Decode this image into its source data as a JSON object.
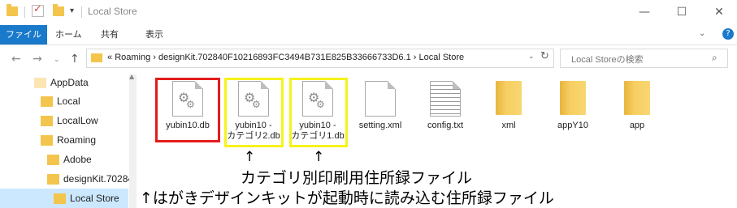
{
  "window": {
    "title": "Local Store",
    "minimize": "—",
    "maximize": "☐",
    "close": "✕"
  },
  "ribbon": {
    "tabs": [
      "ファイル",
      "ホーム",
      "共有",
      "表示"
    ]
  },
  "address": {
    "prefix": "«",
    "path": "Roaming  ›  designKit.702840F10216893FC3494B731E825B33666733D6.1  ›  Local Store"
  },
  "search": {
    "placeholder": "Local Storeの検索"
  },
  "nav_pane": {
    "items": [
      "AppData",
      "Local",
      "LocalLow",
      "Roaming",
      "Adobe",
      "designKit.70284",
      "Local Store"
    ]
  },
  "files": [
    {
      "name": "yubin10.db",
      "icon": "gear-doc"
    },
    {
      "name": "yubin10 -\nカテゴリ2.db",
      "icon": "gear-doc"
    },
    {
      "name": "yubin10 -\nカテゴリ1.db",
      "icon": "gear-doc"
    },
    {
      "name": "setting.xml",
      "icon": "doc"
    },
    {
      "name": "config.txt",
      "icon": "text-doc"
    },
    {
      "name": "xml",
      "icon": "folder"
    },
    {
      "name": "appY10",
      "icon": "folder"
    },
    {
      "name": "app",
      "icon": "folder"
    }
  ],
  "annotations": {
    "arrow": "↑",
    "line1": "カテゴリ別印刷用住所録ファイル",
    "line2": "↑はがきデザインキットが起動時に読み込む住所録ファイル"
  },
  "colors": {
    "accent": "#1979ca",
    "highlight_red": "#e31c1c",
    "highlight_yellow": "#f7f21a",
    "folder": "#f3c54d",
    "selection": "#cce8ff"
  }
}
